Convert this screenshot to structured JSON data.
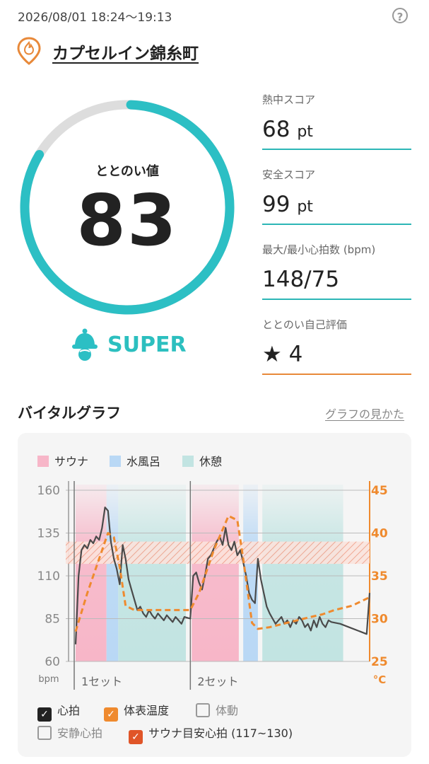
{
  "header": {
    "datetime": "2026/08/01 18:24～19:13",
    "help_glyph": "?"
  },
  "facility": {
    "name": "カプセルイン錦糸町",
    "icon": "sauna-flame-pin-icon",
    "color": "#e8893a"
  },
  "totonoi": {
    "label": "ととのい値",
    "value": "83",
    "progress": 0.83,
    "grade": "SUPER",
    "grade_icon": "sauna-hat-icon",
    "ring_color": "#2cbfc4",
    "track_color": "#dddddd"
  },
  "metrics": [
    {
      "label": "熱中スコア",
      "value": "68",
      "unit": "pt"
    },
    {
      "label": "安全スコア",
      "value": "99",
      "unit": "pt"
    },
    {
      "label": "最大/最小心拍数 (bpm)",
      "value": "148/75",
      "unit": ""
    },
    {
      "label": "ととのい自己評価",
      "value": "4",
      "unit": "",
      "icon": "star-icon"
    }
  ],
  "vital": {
    "title": "バイタルグラフ",
    "guide_link": "グラフの見かた",
    "legend": [
      {
        "label": "サウナ",
        "color": "#f7b6c8"
      },
      {
        "label": "水風呂",
        "color": "#b9d8f5"
      },
      {
        "label": "休憩",
        "color": "#c2e4e2"
      }
    ],
    "checkboxes": [
      {
        "label": "心拍",
        "checked": true
      },
      {
        "label": "体表温度",
        "checked": true
      },
      {
        "label": "体動",
        "checked": false
      },
      {
        "label": "安静心拍",
        "checked": false
      },
      {
        "label": "サウナ目安心拍 (117~130)",
        "checked": true
      }
    ]
  },
  "chart_data": {
    "type": "line",
    "y_left": {
      "unit": "bpm",
      "ticks": [
        "160",
        "135",
        "110",
        "85",
        "60"
      ],
      "range": [
        60,
        160
      ]
    },
    "y_right": {
      "unit": "°C",
      "ticks": [
        "45",
        "40",
        "35",
        "30",
        "25"
      ],
      "range": [
        25,
        45
      ]
    },
    "x_labels": [
      "1セット",
      "2セット"
    ],
    "target_band": [
      117,
      130
    ],
    "segments": [
      {
        "type": "sauna",
        "start": 0.0,
        "end": 0.105
      },
      {
        "type": "water",
        "start": 0.105,
        "end": 0.145
      },
      {
        "type": "rest",
        "start": 0.145,
        "end": 0.375
      },
      {
        "type": "sauna",
        "start": 0.395,
        "end": 0.555
      },
      {
        "type": "water",
        "start": 0.57,
        "end": 0.62
      },
      {
        "type": "rest",
        "start": 0.635,
        "end": 0.91
      }
    ],
    "series": [
      {
        "name": "心拍",
        "color": "#4a4a4a",
        "points": [
          [
            0.0,
            70
          ],
          [
            0.01,
            110
          ],
          [
            0.02,
            125
          ],
          [
            0.03,
            128
          ],
          [
            0.04,
            126
          ],
          [
            0.05,
            131
          ],
          [
            0.06,
            129
          ],
          [
            0.07,
            133
          ],
          [
            0.08,
            131
          ],
          [
            0.09,
            138
          ],
          [
            0.1,
            150
          ],
          [
            0.11,
            148
          ],
          [
            0.12,
            130
          ],
          [
            0.13,
            120
          ],
          [
            0.14,
            114
          ],
          [
            0.15,
            105
          ],
          [
            0.16,
            128
          ],
          [
            0.17,
            120
          ],
          [
            0.18,
            108
          ],
          [
            0.19,
            102
          ],
          [
            0.2,
            96
          ],
          [
            0.21,
            90
          ],
          [
            0.22,
            92
          ],
          [
            0.23,
            88
          ],
          [
            0.24,
            86
          ],
          [
            0.25,
            90
          ],
          [
            0.26,
            87
          ],
          [
            0.27,
            85
          ],
          [
            0.28,
            88
          ],
          [
            0.29,
            86
          ],
          [
            0.3,
            84
          ],
          [
            0.31,
            87
          ],
          [
            0.32,
            85
          ],
          [
            0.33,
            83
          ],
          [
            0.34,
            86
          ],
          [
            0.35,
            84
          ],
          [
            0.36,
            82
          ],
          [
            0.37,
            86
          ],
          [
            0.39,
            85
          ],
          [
            0.4,
            110
          ],
          [
            0.41,
            112
          ],
          [
            0.42,
            106
          ],
          [
            0.43,
            102
          ],
          [
            0.44,
            110
          ],
          [
            0.45,
            120
          ],
          [
            0.46,
            122
          ],
          [
            0.47,
            126
          ],
          [
            0.48,
            130
          ],
          [
            0.49,
            133
          ],
          [
            0.5,
            128
          ],
          [
            0.51,
            138
          ],
          [
            0.52,
            128
          ],
          [
            0.53,
            125
          ],
          [
            0.54,
            130
          ],
          [
            0.55,
            122
          ],
          [
            0.56,
            125
          ],
          [
            0.57,
            118
          ],
          [
            0.58,
            110
          ],
          [
            0.59,
            100
          ],
          [
            0.6,
            96
          ],
          [
            0.61,
            94
          ],
          [
            0.62,
            120
          ],
          [
            0.63,
            108
          ],
          [
            0.64,
            100
          ],
          [
            0.65,
            92
          ],
          [
            0.66,
            88
          ],
          [
            0.67,
            85
          ],
          [
            0.68,
            82
          ],
          [
            0.69,
            84
          ],
          [
            0.7,
            86
          ],
          [
            0.71,
            82
          ],
          [
            0.72,
            84
          ],
          [
            0.73,
            80
          ],
          [
            0.74,
            84
          ],
          [
            0.75,
            82
          ],
          [
            0.76,
            86
          ],
          [
            0.77,
            84
          ],
          [
            0.78,
            80
          ],
          [
            0.79,
            82
          ],
          [
            0.8,
            78
          ],
          [
            0.81,
            84
          ],
          [
            0.82,
            80
          ],
          [
            0.83,
            86
          ],
          [
            0.84,
            82
          ],
          [
            0.85,
            80
          ],
          [
            0.86,
            84
          ],
          [
            0.87,
            83
          ],
          [
            0.9,
            82
          ],
          [
            0.99,
            76
          ],
          [
            1.0,
            100
          ]
        ]
      },
      {
        "name": "体表温度",
        "color": "#ef8a2e",
        "points": [
          [
            0.0,
            28.5
          ],
          [
            0.04,
            33
          ],
          [
            0.08,
            37
          ],
          [
            0.11,
            40
          ],
          [
            0.13,
            39.5
          ],
          [
            0.15,
            36
          ],
          [
            0.17,
            31.5
          ],
          [
            0.2,
            31
          ],
          [
            0.25,
            31
          ],
          [
            0.3,
            31
          ],
          [
            0.35,
            31
          ],
          [
            0.39,
            31
          ],
          [
            0.42,
            33
          ],
          [
            0.47,
            38
          ],
          [
            0.52,
            42
          ],
          [
            0.55,
            41.5
          ],
          [
            0.57,
            37
          ],
          [
            0.6,
            29.5
          ],
          [
            0.62,
            28.8
          ],
          [
            0.66,
            29
          ],
          [
            0.73,
            29.6
          ],
          [
            0.8,
            30.2
          ],
          [
            0.84,
            30.5
          ],
          [
            0.88,
            31
          ],
          [
            0.94,
            31.5
          ],
          [
            1.0,
            32.5
          ]
        ]
      }
    ]
  }
}
